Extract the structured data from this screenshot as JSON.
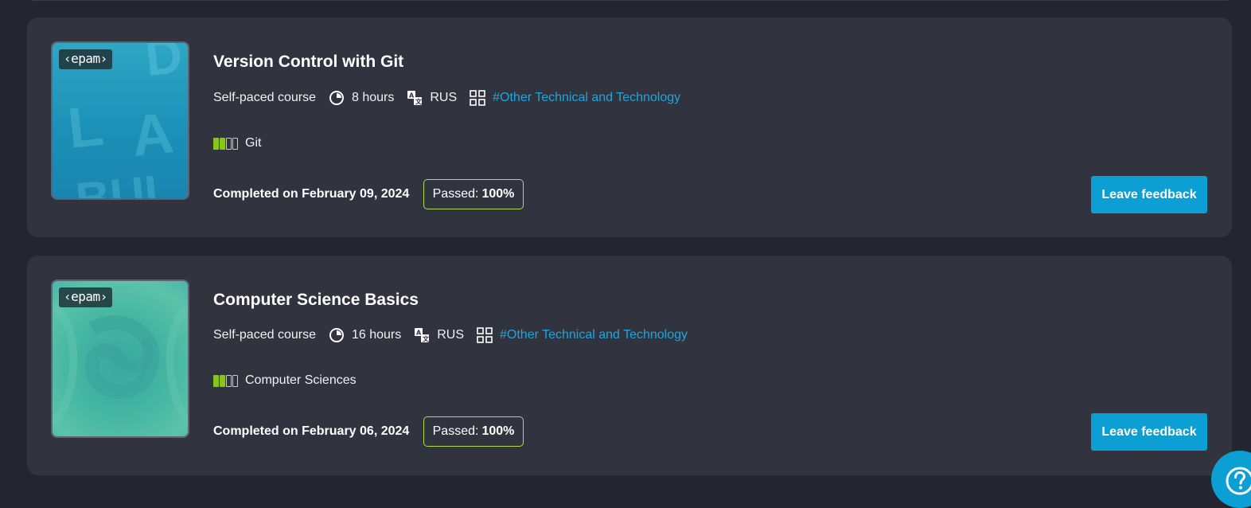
{
  "courses": [
    {
      "title": "Version Control with Git",
      "logo": "‹epam›",
      "thumb_letters": [
        "D",
        "L",
        "A",
        "BUI"
      ],
      "type": "Self-paced course",
      "duration": "8 hours",
      "language": "RUS",
      "tag": "#Other Technical and Technology",
      "skill": "Git",
      "skill_level": 2,
      "completed": "Completed on February 09, 2024",
      "passed_label": "Passed:",
      "passed_value": "100%",
      "feedback_label": "Leave feedback"
    },
    {
      "title": "Computer Science Basics",
      "logo": "‹epam›",
      "type": "Self-paced course",
      "duration": "16 hours",
      "language": "RUS",
      "tag": "#Other Technical and Technology",
      "skill": "Computer Sciences",
      "skill_level": 2,
      "completed": "Completed on February 06, 2024",
      "passed_label": "Passed:",
      "passed_value": "100%",
      "feedback_label": "Leave feedback"
    }
  ],
  "icons": {
    "duration": "clock-icon",
    "language": "translate-icon",
    "category": "grid-icon",
    "help": "question-icon"
  },
  "colors": {
    "background": "#23252f",
    "card": "#31333f",
    "accent": "#0b9fd3",
    "tag": "#1fa6dc",
    "level_on": "#8ac51a",
    "passed_border": "#b8d94a"
  }
}
